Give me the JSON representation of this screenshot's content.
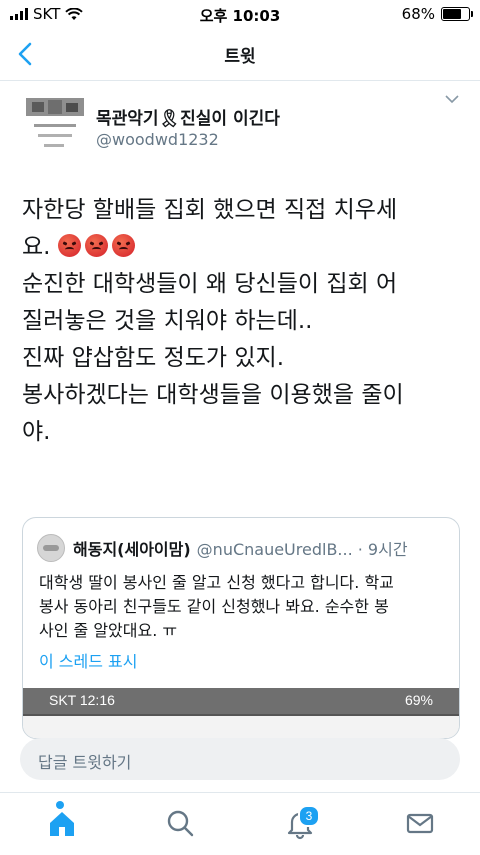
{
  "status_bar": {
    "carrier": "SKT",
    "time": "오후 10:03",
    "battery": "68%",
    "battery_level": 0.68
  },
  "nav": {
    "title": "트윗"
  },
  "tweet": {
    "author_name": "목관악기🎗진실이 이긴다",
    "author_handle": "@woodwd1232",
    "lines": [
      "자한당 할배들 집회 했으면 직접 치우세",
      "요.",
      "순진한 대학생들이 왜 당신들이 집회 어",
      "질러놓은 것을 치워야 하는데..",
      "진짜 얍삽함도 정도가 있지.",
      "봉사하겠다는 대학생들을 이용했을 줄이",
      "야."
    ]
  },
  "quote": {
    "name": "해동지(세아이맘)",
    "handle": "@nuCnaueUredlB... · 9시간",
    "lines": [
      "대학생 딸이 봉사인 줄 알고 신청 했다고 합니다. 학교",
      "봉사 동아리 친구들도 같이 신청했나 봐요. 순수한 봉",
      "사인 줄 알았대요. ㅠ"
    ],
    "show_thread": "이 스레드 표시",
    "embedded_status": {
      "left": "SKT 12:16",
      "right": "69%"
    }
  },
  "reply": {
    "placeholder": "답글 트윗하기"
  },
  "tabs": {
    "notifications_count": "3"
  },
  "colors": {
    "accent": "#1da1f2",
    "text": "#14171a",
    "secondary": "#657786",
    "border": "#e1e8ed"
  }
}
